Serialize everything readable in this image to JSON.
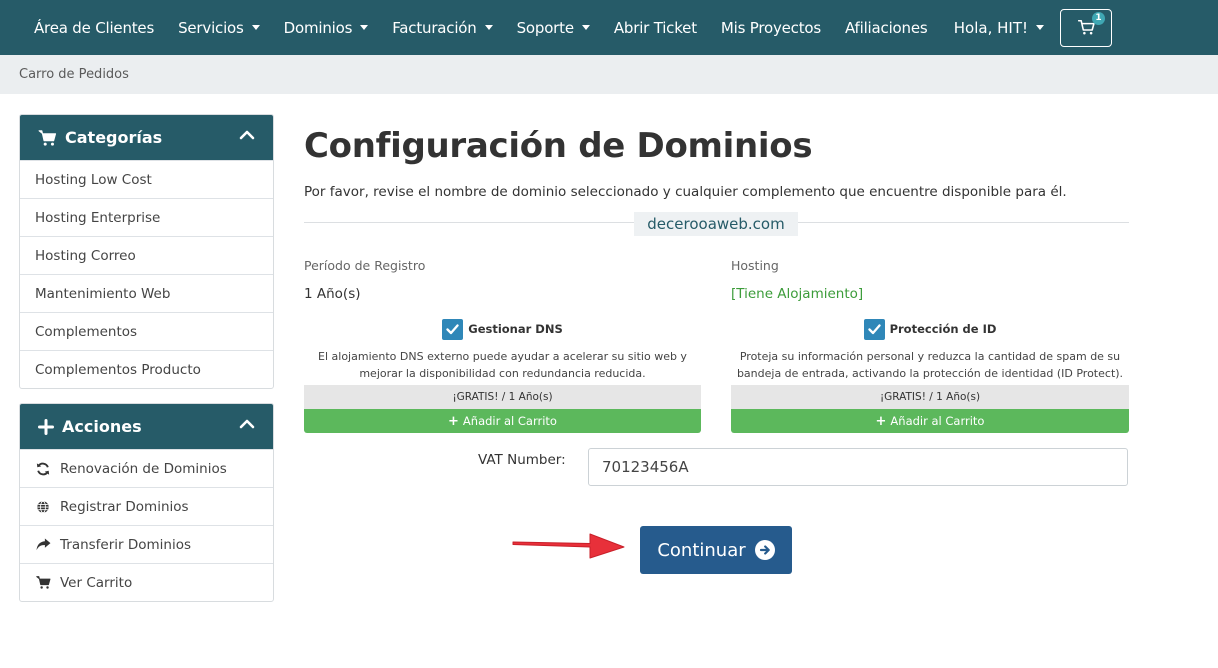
{
  "navbar": {
    "items": [
      {
        "label": "Área de Clientes",
        "dropdown": false
      },
      {
        "label": "Servicios",
        "dropdown": true
      },
      {
        "label": "Dominios",
        "dropdown": true
      },
      {
        "label": "Facturación",
        "dropdown": true
      },
      {
        "label": "Soporte",
        "dropdown": true
      },
      {
        "label": "Abrir Ticket",
        "dropdown": false
      },
      {
        "label": "Mis Proyectos",
        "dropdown": false
      },
      {
        "label": "Afiliaciones",
        "dropdown": false
      }
    ],
    "greeting": "Hola, HIT!",
    "cart_icon": "cart-icon",
    "cart_count": "1"
  },
  "breadcrumb": "Carro de Pedidos",
  "categories": {
    "title": "Categorías",
    "icon": "cart-icon",
    "items": [
      "Hosting Low Cost",
      "Hosting Enterprise",
      "Hosting Correo",
      "Mantenimiento Web",
      "Complementos",
      "Complementos Producto"
    ]
  },
  "actions": {
    "title": "Acciones",
    "icon": "plus-icon",
    "items": [
      {
        "label": "Renovación de Dominios",
        "icon": "refresh-icon"
      },
      {
        "label": "Registrar Dominios",
        "icon": "globe-icon"
      },
      {
        "label": "Transferir Dominios",
        "icon": "share-icon"
      },
      {
        "label": "Ver Carrito",
        "icon": "cart-icon"
      }
    ]
  },
  "main": {
    "title": "Configuración de Dominios",
    "subtitle": "Por favor, revise el nombre de dominio seleccionado y cualquier complemento que encuentre disponible para él.",
    "domain": "decerooaweb.com",
    "period_label": "Período de Registro",
    "period_value": "1 Año(s)",
    "hosting_label": "Hosting",
    "hosting_value": "[Tiene Alojamiento]",
    "addons": [
      {
        "name": "Gestionar DNS",
        "checked": true,
        "description": "El alojamiento DNS externo puede ayudar a acelerar su sitio web y mejorar la disponibilidad con redundancia reducida.",
        "price": "¡GRATIS! / 1 Año(s)",
        "add_label": "Añadir al Carrito"
      },
      {
        "name": "Protección de ID",
        "checked": true,
        "description": "Proteja su información personal y reduzca la cantidad de spam de su bandeja de entrada, activando la protección de identidad (ID Protect).",
        "price": "¡GRATIS! / 1 Año(s)",
        "add_label": "Añadir al Carrito"
      }
    ],
    "vat_label": "VAT Number:",
    "vat_value": "70123456A",
    "continue_label": "Continuar"
  },
  "colors": {
    "navbar": "#265b68",
    "checkbox": "#2f87b8",
    "add_button": "#5cb85c",
    "continue_button": "#265b8d",
    "hosting_text": "#3c9c3a",
    "annotation_arrow": "#e8303a"
  }
}
